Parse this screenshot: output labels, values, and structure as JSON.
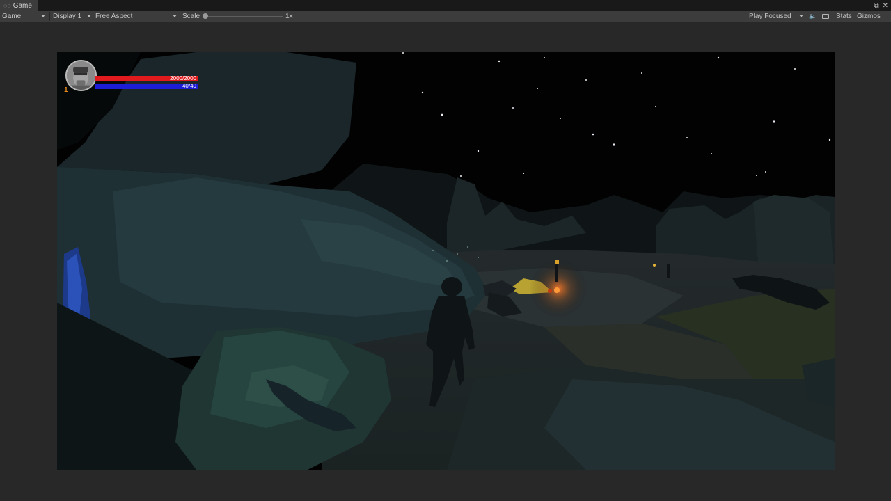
{
  "tab": {
    "title": "Game",
    "icon": "gamepad-icon"
  },
  "window_controls": {
    "menu": "⋮",
    "maximize": "⧉",
    "close": "✕"
  },
  "toolbar": {
    "view_mode": "Game",
    "display": "Display 1",
    "aspect": "Free Aspect",
    "scale_label": "Scale",
    "scale_value": "1x",
    "scale_level": 0,
    "play_mode": "Play Focused",
    "mute_icon": "speaker-icon",
    "stats_icon": "stats-window-icon",
    "stats_label": "Stats",
    "gizmos_label": "Gizmos"
  },
  "hud": {
    "health_text": "2000/2000",
    "health_fraction": 1.0,
    "mana_text": "40/40",
    "mana_fraction": 1.0,
    "level": "1",
    "colors": {
      "health": "#e01a1d",
      "mana": "#1d1dd6",
      "level": "#e68a1c"
    }
  }
}
